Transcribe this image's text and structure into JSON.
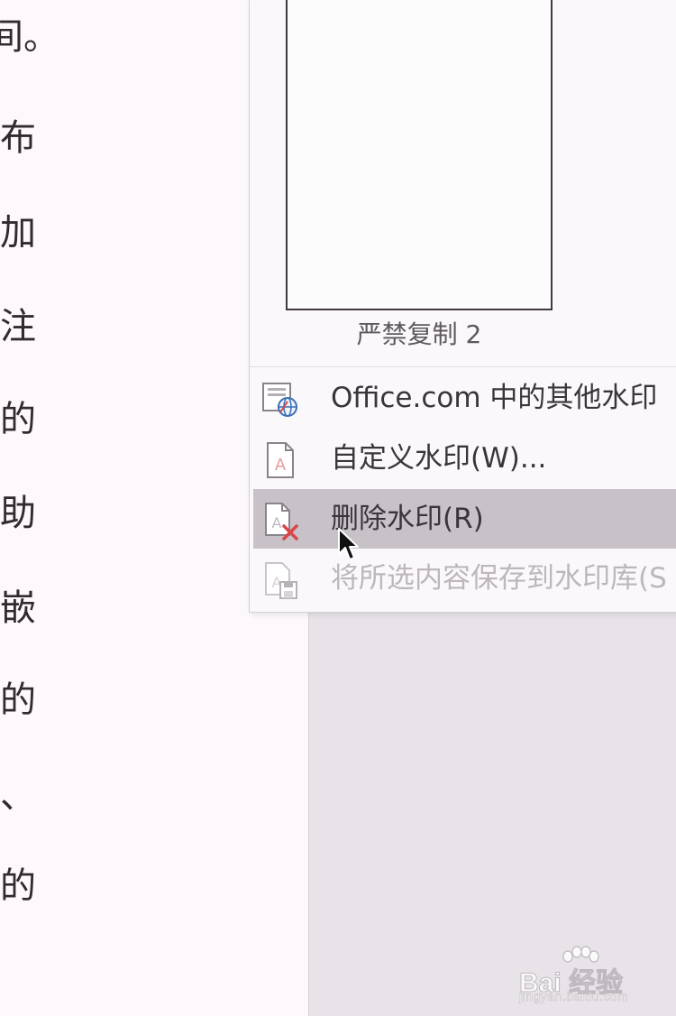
{
  "document": {
    "lines": [
      "间。",
      "布",
      "加",
      "注",
      "的",
      "助",
      "嵌",
      "的",
      "、",
      "的"
    ]
  },
  "watermark_menu": {
    "gallery": {
      "thumbnail_caption": "严禁复制 2"
    },
    "items": [
      {
        "label": "Office.com 中的其他水印",
        "icon": "watermark-web-icon",
        "state": "normal"
      },
      {
        "label": "自定义水印(W)...",
        "icon": "custom-watermark-icon",
        "state": "normal"
      },
      {
        "label": "删除水印(R)",
        "icon": "remove-watermark-icon",
        "state": "hover"
      },
      {
        "label": "将所选内容保存到水印库(S",
        "icon": "save-to-gallery-icon",
        "state": "disabled"
      }
    ]
  },
  "branding": {
    "logo_text": "Bai 经验",
    "url_text": "jingyan.baidu.com"
  },
  "colors": {
    "menu_background": "#fbf8fb",
    "highlight": "#c8c1c8",
    "icon_red": "#d8464a",
    "disabled_text": "#bdb7bd"
  }
}
